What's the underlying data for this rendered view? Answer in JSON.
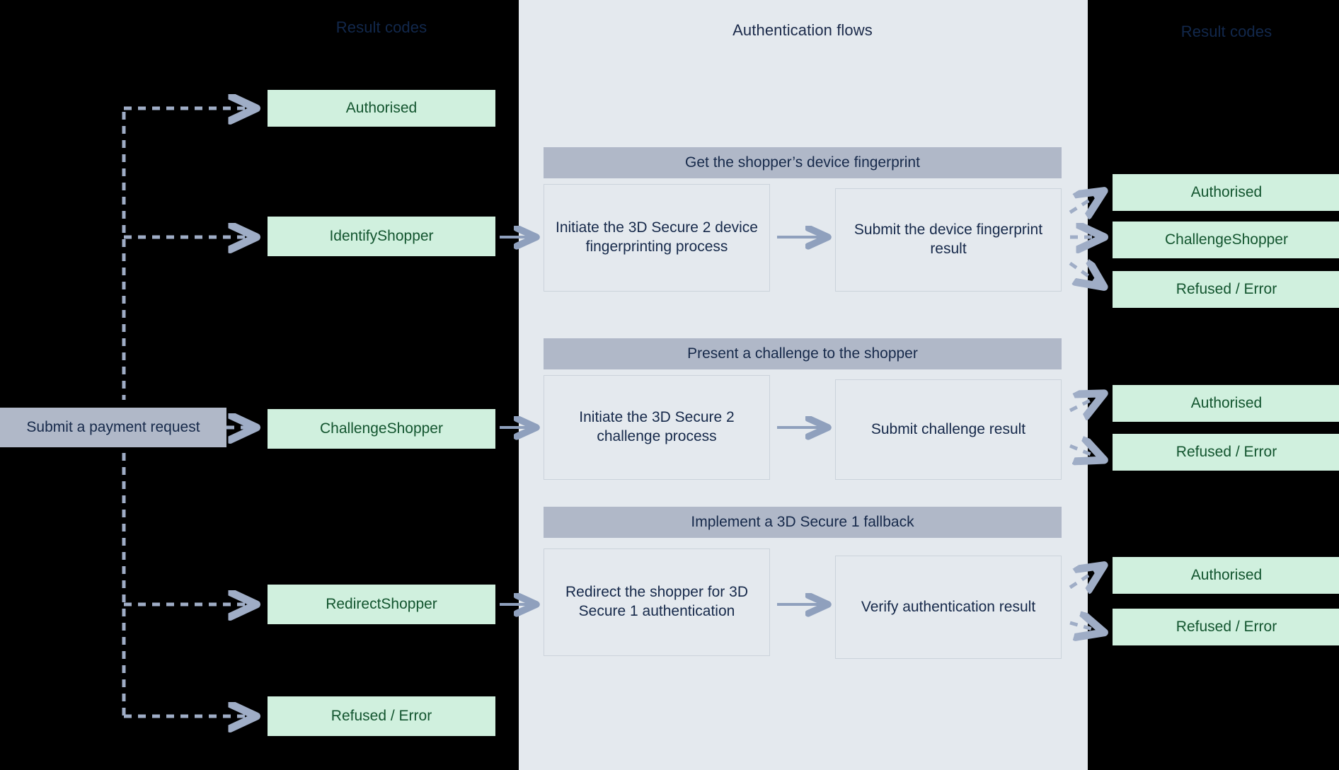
{
  "columns": {
    "left_title": "Result codes",
    "mid_title": "Authentication flows",
    "right_title": "Result codes"
  },
  "colors": {
    "panel_dark": "#000000",
    "panel_mid": "#e4e9ee",
    "result_code_bg": "#d0f0de",
    "result_code_text": "#13552f",
    "header_bg": "#b0b8c8",
    "header_text": "#16294a",
    "connector": "#9fadc6"
  },
  "entry": {
    "label": "Submit a payment request"
  },
  "left_result_codes": [
    {
      "label": "Authorised"
    },
    {
      "label": "IdentifyShopper"
    },
    {
      "label": "ChallengeShopper"
    },
    {
      "label": "RedirectShopper"
    },
    {
      "label": "Refused / Error"
    }
  ],
  "flows": [
    {
      "header": "Get the shopper’s device fingerprint",
      "steps": [
        "Initiate the 3D Secure 2 device fingerprinting process",
        "Submit the device fingerprint result"
      ],
      "outcomes": [
        "Authorised",
        "ChallengeShopper",
        "Refused / Error"
      ]
    },
    {
      "header": "Present a challenge to the shopper",
      "steps": [
        "Initiate the 3D Secure 2 challenge process",
        "Submit challenge result"
      ],
      "outcomes": [
        "Authorised",
        "Refused / Error"
      ]
    },
    {
      "header": "Implement a 3D Secure 1 fallback",
      "steps": [
        "Redirect the shopper for 3D Secure 1 authentication",
        "Verify authentication result"
      ],
      "outcomes": [
        "Authorised",
        "Refused / Error"
      ]
    }
  ],
  "right_result_codes": [
    {
      "label": "Authorised"
    },
    {
      "label": "ChallengeShopper"
    },
    {
      "label": "Refused / Error"
    },
    {
      "label": "Authorised"
    },
    {
      "label": "Refused / Error"
    },
    {
      "label": "Authorised"
    },
    {
      "label": "Refused / Error"
    }
  ]
}
